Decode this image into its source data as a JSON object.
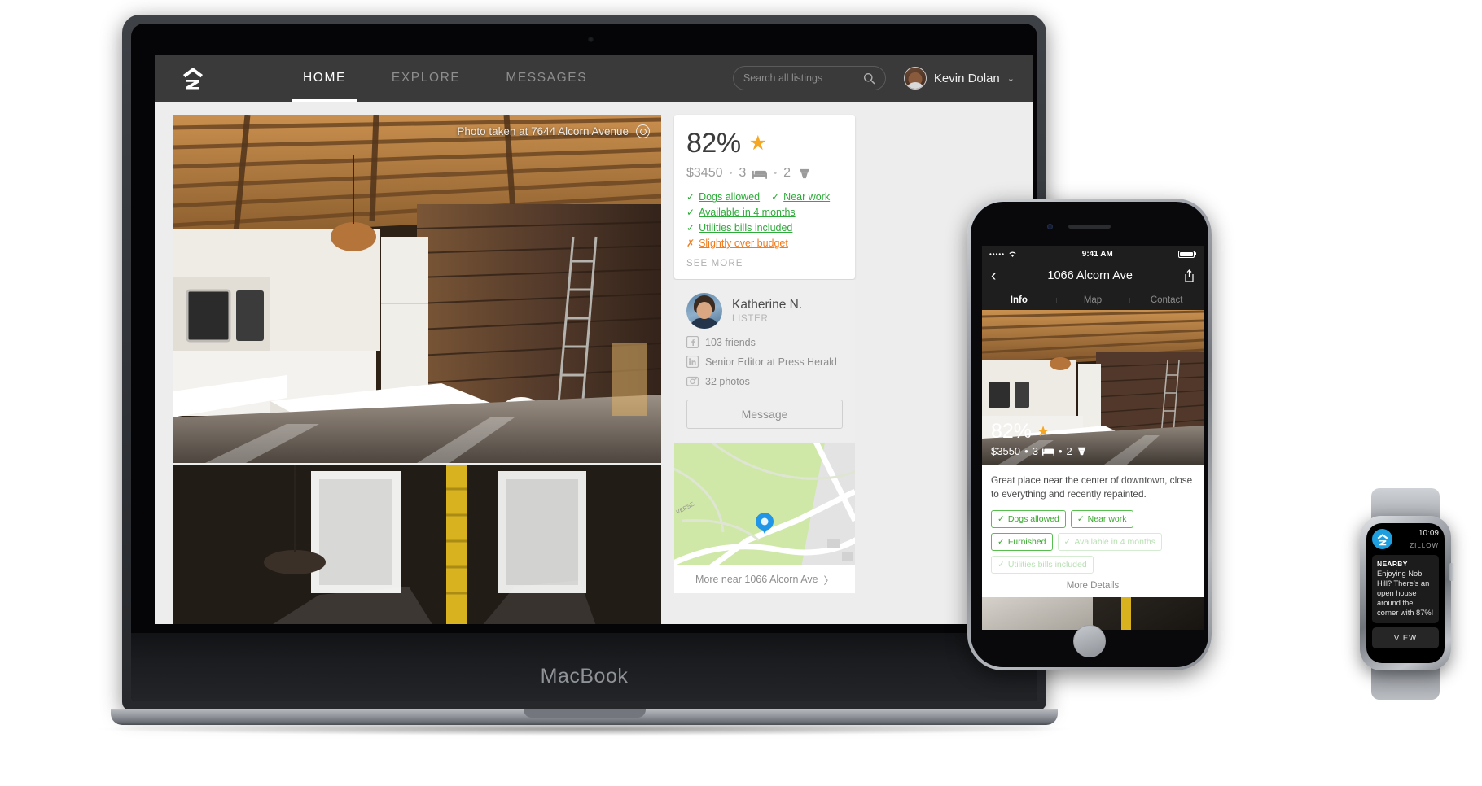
{
  "macbook": {
    "wordmark": "MacBook",
    "nav": {
      "logo": "zillow-logo-icon",
      "tabs": [
        {
          "label": "HOME",
          "active": true
        },
        {
          "label": "EXPLORE",
          "active": false
        },
        {
          "label": "MESSAGES",
          "active": false
        }
      ],
      "search": {
        "placeholder": "Search all listings",
        "icon": "search-icon"
      },
      "user": {
        "name": "Kevin Dolan",
        "caret": "⌄"
      }
    },
    "photo": {
      "caption": "Photo taken at 7644 Alcorn Avenue",
      "pin_icon": "location-pin-icon"
    },
    "listing": {
      "match_percent": "82%",
      "star": "★",
      "price": "$3450",
      "beds": "3",
      "baths": "2",
      "dot": "•",
      "features": [
        {
          "label": "Dogs allowed",
          "ok": true,
          "mark": "✓"
        },
        {
          "label": "Near work",
          "ok": true,
          "mark": "✓"
        },
        {
          "label": "Available in 4 months",
          "ok": true,
          "mark": "✓"
        },
        {
          "label": "Utilities bills included",
          "ok": true,
          "mark": "✓"
        },
        {
          "label": "Slightly over budget",
          "ok": false,
          "mark": "✗"
        }
      ],
      "see_more": "SEE MORE"
    },
    "lister": {
      "name": "Katherine N.",
      "role": "LISTER",
      "stats": [
        {
          "icon": "facebook-icon",
          "label": "103 friends"
        },
        {
          "icon": "linkedin-icon",
          "label": "Senior Editor at Press Herald"
        },
        {
          "icon": "camera-icon",
          "label": "32 photos"
        }
      ],
      "message_button": "Message"
    },
    "map": {
      "footer_label": "More near 1066 Alcorn Ave",
      "chevron": "〉",
      "street_label": "VERSE",
      "pin_icon": "map-pin-icon"
    }
  },
  "iphone": {
    "status": {
      "signal": "•••••",
      "carrier_wifi": "wifi-icon",
      "time": "9:41 AM",
      "battery": "battery-full-icon"
    },
    "nav": {
      "back": "‹",
      "title": "1066 Alcorn Ave",
      "share": "share-icon"
    },
    "tabs": [
      {
        "label": "Info",
        "active": true
      },
      {
        "label": "Map",
        "active": false
      },
      {
        "label": "Contact",
        "active": false
      }
    ],
    "hero": {
      "match_percent": "82%",
      "star": "★",
      "price": "$3550",
      "beds": "3",
      "baths": "2",
      "dot": "•"
    },
    "description": "Great place near the center of downtown, close to everything and recently repainted.",
    "chips": [
      {
        "label": "Dogs allowed",
        "mark": "✓",
        "dim": false
      },
      {
        "label": "Near work",
        "mark": "✓",
        "dim": false
      },
      {
        "label": "Furnished",
        "mark": "✓",
        "dim": false
      },
      {
        "label": "Available in 4 months",
        "mark": "✓",
        "dim": true
      },
      {
        "label": "Utilities bills included",
        "mark": "✓",
        "dim": true
      }
    ],
    "more_details": "More Details"
  },
  "watch": {
    "time": "10:09",
    "brand": "ZILLOW",
    "kicker": "NEARBY",
    "message": "Enjoying Nob Hill? There’s an open house around the corner with 87%!",
    "view_button": "VIEW",
    "app_icon": "zillow-logo-icon"
  },
  "colors": {
    "nav_bg": "#3a3a3a",
    "accent_green": "#2eab3a",
    "accent_orange": "#f07c1e",
    "star_gold": "#f5a623",
    "map_blue": "#2196e8",
    "page_bg": "#ededed"
  }
}
